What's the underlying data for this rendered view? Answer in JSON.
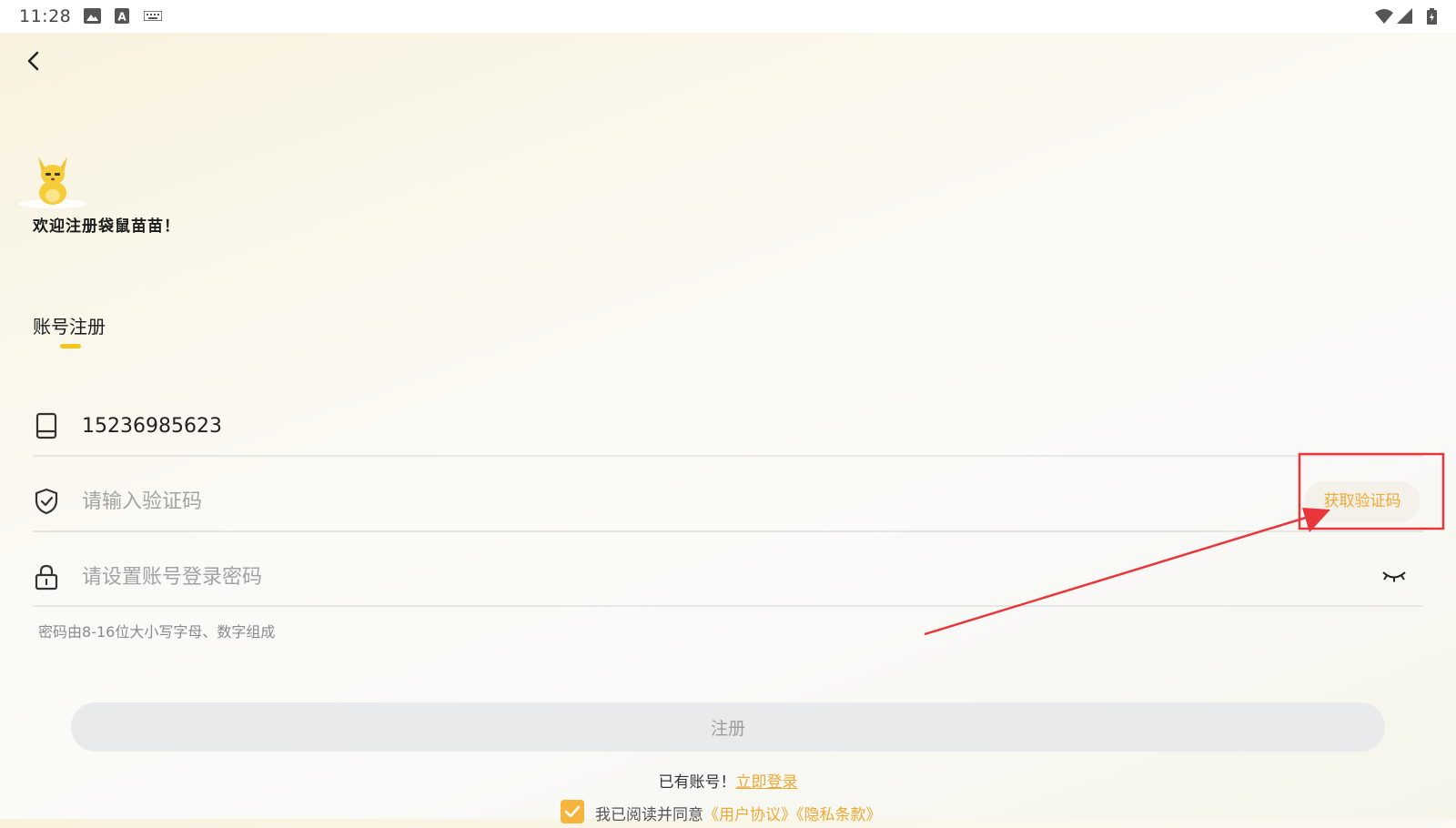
{
  "status_bar": {
    "time": "11:28",
    "icons": [
      "image-icon",
      "a-letter-icon",
      "keyboard-icon",
      "wifi-icon",
      "cellular-icon",
      "battery-icon"
    ]
  },
  "header": {
    "back_icon": "chevron-left-icon"
  },
  "welcome": {
    "mascot_icon": "kangaroo-mascot",
    "title": "欢迎注册袋鼠苗苗！"
  },
  "tab": {
    "title": "账号注册"
  },
  "phone_field": {
    "icon": "phone-icon",
    "value": "15236985623",
    "placeholder": ""
  },
  "code_field": {
    "icon": "shield-check-icon",
    "value": "",
    "placeholder": "请输入验证码",
    "get_code_label": "获取验证码"
  },
  "password_field": {
    "icon": "lock-icon",
    "value": "",
    "placeholder": "请设置账号登录密码",
    "toggle_icon": "eye-closed-icon",
    "hint": "密码由8-16位大小写字母、数字组成"
  },
  "register_button": {
    "label": "注册"
  },
  "login_prompt": {
    "text": "已有账号！",
    "link": "立即登录"
  },
  "agreement": {
    "checked": true,
    "prefix": "我已阅读并同意",
    "user_agreement": "《用户协议》",
    "privacy": "《隐私条款》"
  },
  "colors": {
    "accent": "#f0a834",
    "tab_indicator": "#f5c617",
    "annotation": "#e8363b"
  }
}
